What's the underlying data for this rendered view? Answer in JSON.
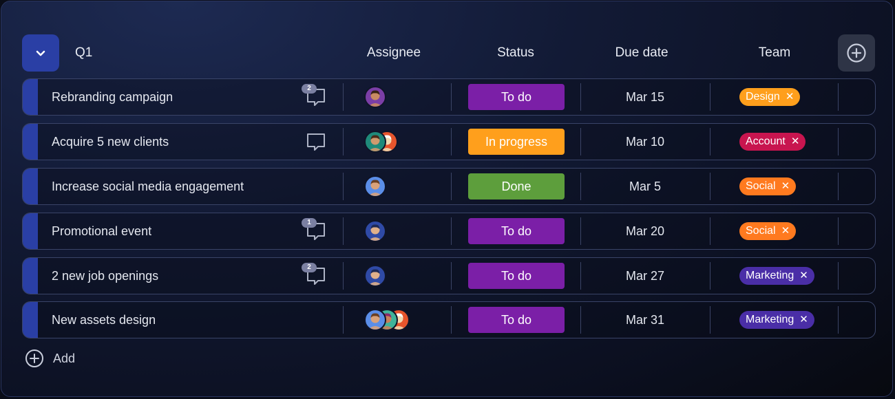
{
  "group": {
    "title": "Q1"
  },
  "columns": {
    "assignee": "Assignee",
    "status": "Status",
    "due_date": "Due date",
    "team": "Team"
  },
  "status_colors": {
    "To do": "#7b1fa7",
    "In progress": "#ff9f1c",
    "Done": "#5d9e3c"
  },
  "team_colors": {
    "Design": "#ff9f1c",
    "Account": "#c8154f",
    "Social": "#ff7a1f",
    "Marketing": "#4a2ea7"
  },
  "rows": [
    {
      "name": "Rebranding campaign",
      "comments": "2",
      "has_comment_icon": true,
      "avatars": [
        "avatar-purple-man"
      ],
      "status": "To do",
      "due": "Mar 15",
      "team": "Design"
    },
    {
      "name": "Acquire 5 new clients",
      "comments": "",
      "has_comment_icon": true,
      "avatars": [
        "avatar-teal-man",
        "avatar-dog"
      ],
      "status": "In progress",
      "due": "Mar 10",
      "team": "Account"
    },
    {
      "name": "Increase social media engagement",
      "comments": "",
      "has_comment_icon": false,
      "avatars": [
        "avatar-blue-man"
      ],
      "status": "Done",
      "due": "Mar 5",
      "team": "Social"
    },
    {
      "name": "Promotional event",
      "comments": "1",
      "has_comment_icon": true,
      "avatars": [
        "avatar-navy-man"
      ],
      "status": "To do",
      "due": "Mar 20",
      "team": "Social"
    },
    {
      "name": "2 new job openings",
      "comments": "2",
      "has_comment_icon": true,
      "avatars": [
        "avatar-navy-man"
      ],
      "status": "To do",
      "due": "Mar 27",
      "team": "Marketing"
    },
    {
      "name": "New assets design",
      "comments": "",
      "has_comment_icon": false,
      "avatars": [
        "avatar-blue-man",
        "avatar-teal-woman",
        "avatar-dog"
      ],
      "status": "To do",
      "due": "Mar 31",
      "team": "Marketing"
    }
  ],
  "add_label": "Add",
  "icons": {
    "collapse": "chevron-down-icon",
    "add_column": "plus-circle-icon",
    "add_row": "plus-circle-icon",
    "comment": "comment-bubble-icon",
    "remove_tag": "close-icon"
  }
}
